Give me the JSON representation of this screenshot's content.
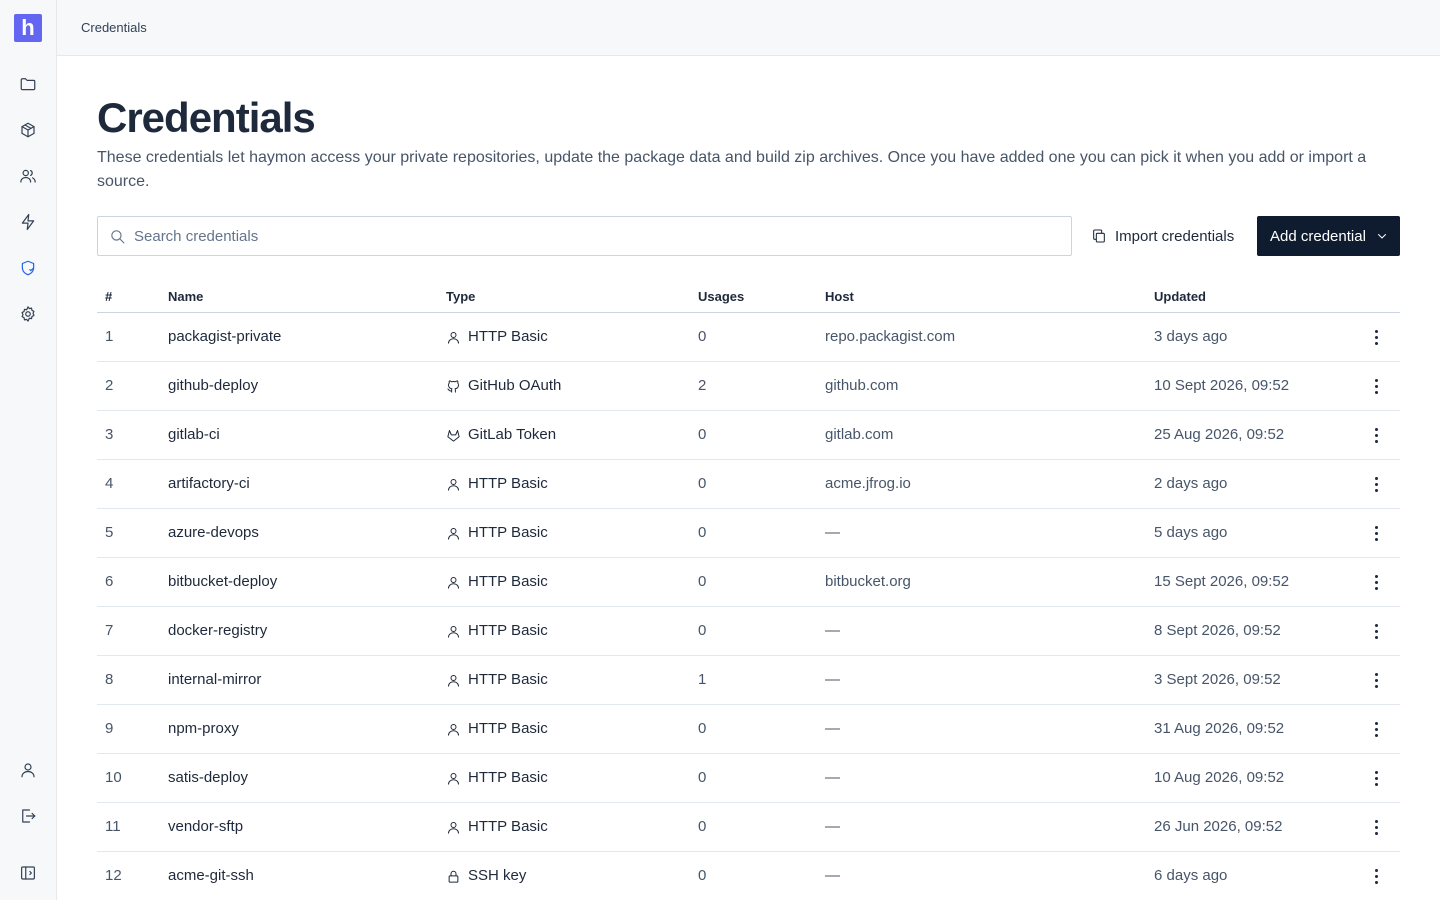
{
  "brand": {
    "logo_letter": "h",
    "accent": "#6366f1"
  },
  "breadcrumb": "Credentials",
  "sidebar": {
    "items": [
      {
        "name": "folder-icon"
      },
      {
        "name": "package-icon"
      },
      {
        "name": "users-icon"
      },
      {
        "name": "bolt-icon"
      },
      {
        "name": "shield-icon",
        "active": true
      },
      {
        "name": "gear-icon"
      }
    ],
    "bottom": [
      {
        "name": "user-icon"
      },
      {
        "name": "logout-icon"
      },
      {
        "name": "sidebar-toggle-icon"
      }
    ]
  },
  "page": {
    "title": "Credentials",
    "description": "These credentials let haymon access your private repositories, update the package data and build zip archives. Once you have added one you can pick it when you add or import a source."
  },
  "search": {
    "placeholder": "Search credentials",
    "value": ""
  },
  "actions": {
    "import_label": "Import credentials",
    "add_label": "Add credential"
  },
  "table": {
    "columns": [
      "#",
      "Name",
      "Type",
      "Usages",
      "Host",
      "Updated"
    ],
    "rows": [
      {
        "num": "1",
        "name": "packagist-private",
        "type": "HTTP Basic",
        "type_icon": "user",
        "usages": "0",
        "host": "repo.packagist.com",
        "updated": "3 days ago"
      },
      {
        "num": "2",
        "name": "github-deploy",
        "type": "GitHub OAuth",
        "type_icon": "github",
        "usages": "2",
        "host": "github.com",
        "updated": "10 Sept 2026, 09:52"
      },
      {
        "num": "3",
        "name": "gitlab-ci",
        "type": "GitLab Token",
        "type_icon": "gitlab",
        "usages": "0",
        "host": "gitlab.com",
        "updated": "25 Aug 2026, 09:52"
      },
      {
        "num": "4",
        "name": "artifactory-ci",
        "type": "HTTP Basic",
        "type_icon": "user",
        "usages": "0",
        "host": "acme.jfrog.io",
        "updated": "2 days ago"
      },
      {
        "num": "5",
        "name": "azure-devops",
        "type": "HTTP Basic",
        "type_icon": "user",
        "usages": "0",
        "host": "—",
        "updated": "5 days ago"
      },
      {
        "num": "6",
        "name": "bitbucket-deploy",
        "type": "HTTP Basic",
        "type_icon": "user",
        "usages": "0",
        "host": "bitbucket.org",
        "updated": "15 Sept 2026, 09:52"
      },
      {
        "num": "7",
        "name": "docker-registry",
        "type": "HTTP Basic",
        "type_icon": "user",
        "usages": "0",
        "host": "—",
        "updated": "8 Sept 2026, 09:52"
      },
      {
        "num": "8",
        "name": "internal-mirror",
        "type": "HTTP Basic",
        "type_icon": "user",
        "usages": "1",
        "host": "—",
        "updated": "3 Sept 2026, 09:52"
      },
      {
        "num": "9",
        "name": "npm-proxy",
        "type": "HTTP Basic",
        "type_icon": "user",
        "usages": "0",
        "host": "—",
        "updated": "31 Aug 2026, 09:52"
      },
      {
        "num": "10",
        "name": "satis-deploy",
        "type": "HTTP Basic",
        "type_icon": "user",
        "usages": "0",
        "host": "—",
        "updated": "10 Aug 2026, 09:52"
      },
      {
        "num": "11",
        "name": "vendor-sftp",
        "type": "HTTP Basic",
        "type_icon": "user",
        "usages": "0",
        "host": "—",
        "updated": "26 Jun 2026, 09:52"
      },
      {
        "num": "12",
        "name": "acme-git-ssh",
        "type": "SSH key",
        "type_icon": "lock",
        "usages": "0",
        "host": "—",
        "updated": "6 days ago"
      }
    ]
  }
}
